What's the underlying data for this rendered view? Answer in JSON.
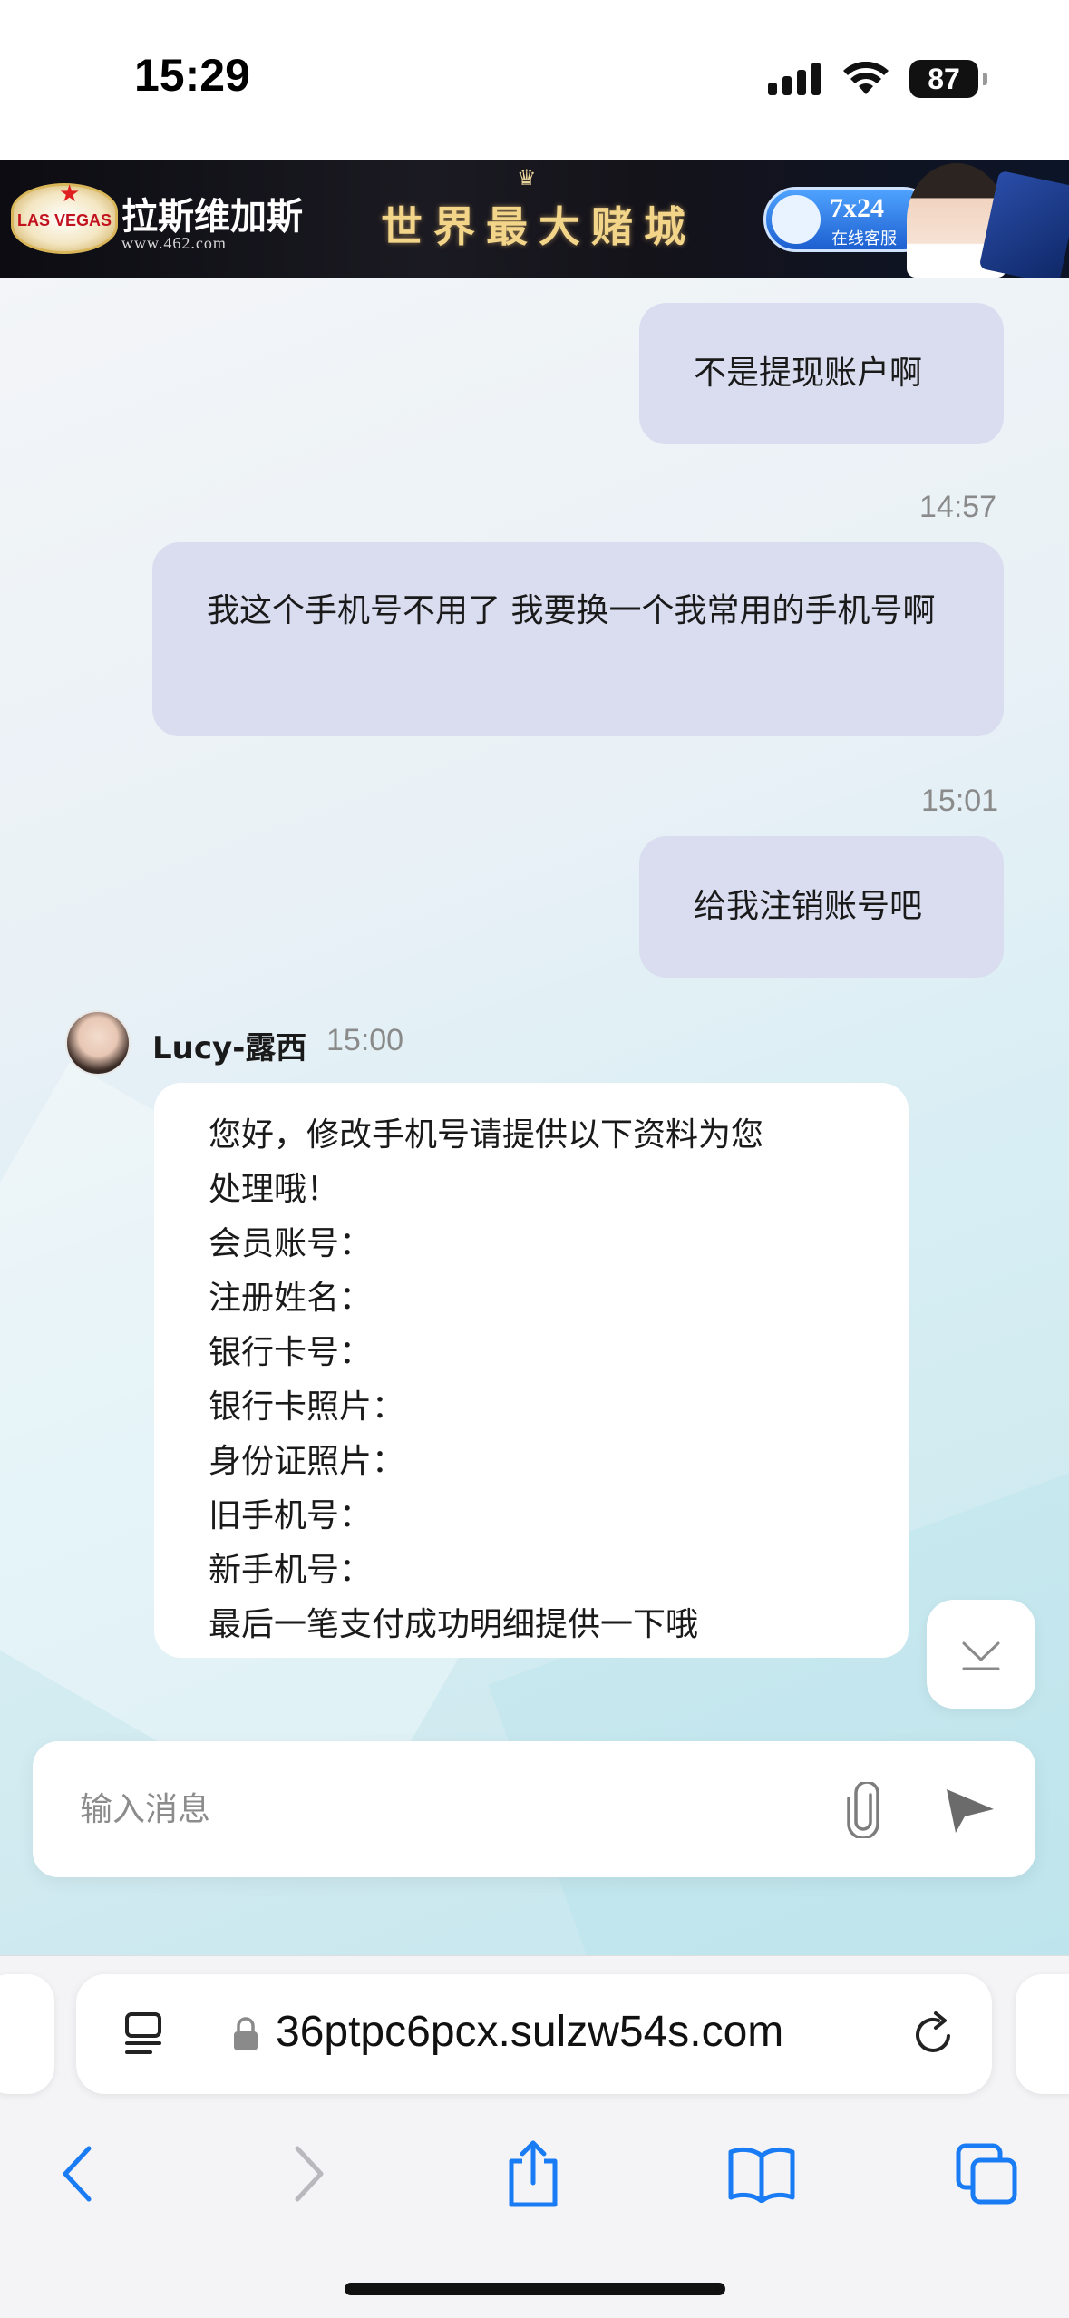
{
  "status_bar": {
    "time": "15:29",
    "battery": "87"
  },
  "banner": {
    "logo_text": "LAS VEGAS",
    "brand": "拉斯维加斯",
    "url": "www.462.com",
    "slogan": "世界最大赌城",
    "service_hours": "7x24",
    "service_label": "在线客服"
  },
  "messages": [
    {
      "direction": "out",
      "text": "不是提现账户啊"
    },
    {
      "direction": "out",
      "time": "14:57",
      "text": "我这个手机号不用了 我要换一个我常用的手机号啊"
    },
    {
      "direction": "out",
      "time": "15:01",
      "text": "给我注销账号吧"
    }
  ],
  "agent_message": {
    "name": "Lucy-露西",
    "time": "15:00",
    "lines": [
      "您好，修改手机号请提供以下资料为您",
      "处理哦！",
      "会员账号：",
      "注册姓名：",
      "银行卡号：",
      "银行卡照片：",
      "身份证照片：",
      "旧手机号：",
      "新手机号：",
      "最后一笔支付成功明细提供一下哦"
    ]
  },
  "composer": {
    "placeholder": "输入消息"
  },
  "browser": {
    "url": "36ptpc6pcx.sulzw54s.com"
  },
  "colors": {
    "outgoing_bubble": "#d9ddef",
    "incoming_bubble": "#ffffff",
    "ios_blue": "#1a7cf5"
  },
  "icons": [
    "signal-icon",
    "wifi-icon",
    "battery-icon",
    "attach-icon",
    "send-icon",
    "scroll-down-icon",
    "reader-icon",
    "lock-icon",
    "reload-icon",
    "back-icon",
    "forward-icon",
    "share-icon",
    "bookmarks-icon",
    "tabs-icon"
  ]
}
